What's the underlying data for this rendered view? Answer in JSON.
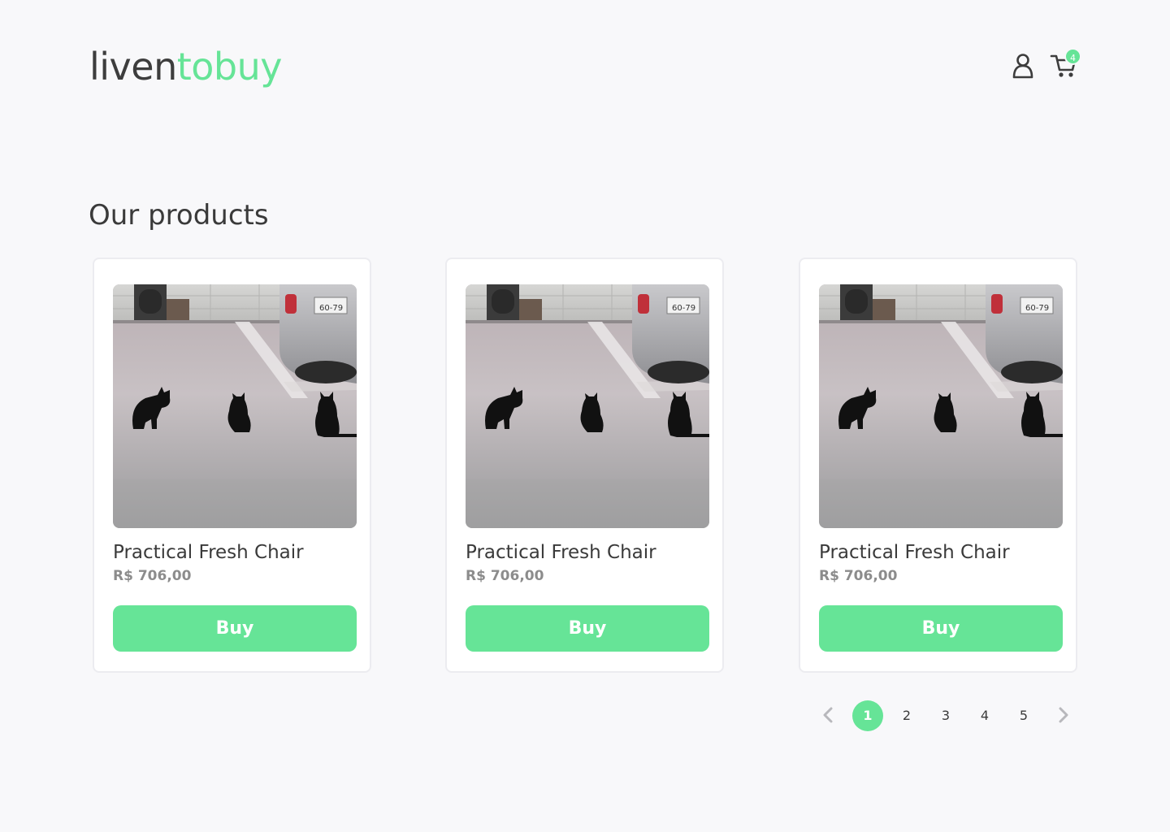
{
  "brand": {
    "part1": "liven",
    "part2": "tobuy",
    "accent_color": "#66e497",
    "dark_color": "#3d3d3d"
  },
  "header": {
    "icons": [
      "user-icon",
      "cart-icon"
    ],
    "cart_count": "4"
  },
  "page": {
    "title": "Our products"
  },
  "products": [
    {
      "name": "Practical Fresh Chair",
      "price": "R$ 706,00",
      "button_label": "Buy",
      "image": "three-black-cats-parking-lot"
    },
    {
      "name": "Practical Fresh Chair",
      "price": "R$ 706,00",
      "button_label": "Buy",
      "image": "three-black-cats-parking-lot"
    },
    {
      "name": "Practical Fresh Chair",
      "price": "R$ 706,00",
      "button_label": "Buy",
      "image": "three-black-cats-parking-lot"
    }
  ],
  "pagination": {
    "pages": [
      "1",
      "2",
      "3",
      "4",
      "5"
    ],
    "current": "1",
    "prev_icon": "chevron-left-icon",
    "next_icon": "chevron-right-icon"
  }
}
